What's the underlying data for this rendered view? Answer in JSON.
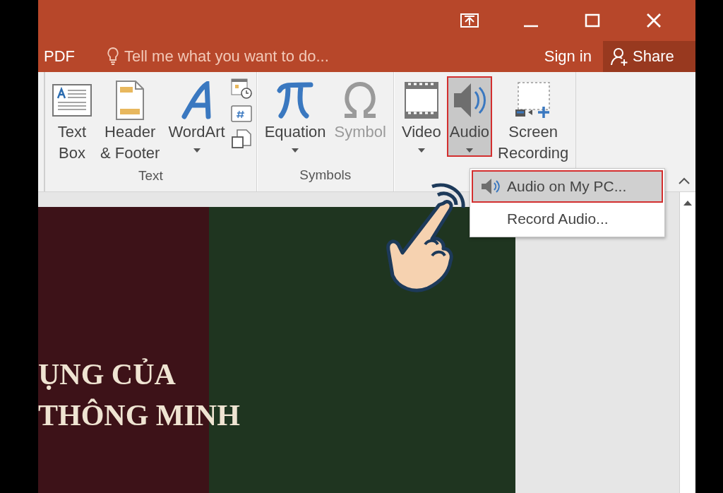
{
  "title_bar": {
    "controls": [
      {
        "kind": "ribbon_options"
      },
      {
        "kind": "minimize"
      },
      {
        "kind": "maximize"
      },
      {
        "kind": "close"
      }
    ]
  },
  "tell_me_row": {
    "tab": "PDF",
    "tell_me": {
      "placeholder": "Tell me what you want to do..."
    },
    "sign_in": "Sign in",
    "share": "Share"
  },
  "ribbon": {
    "groups": [
      {
        "label": "Text",
        "buttons": [
          {
            "kind": "large",
            "lines": [
              "Text",
              "Box"
            ],
            "dropdown": false,
            "disabled": false,
            "selected": false
          },
          {
            "kind": "large",
            "lines": [
              "Header",
              "& Footer"
            ],
            "dropdown": false,
            "disabled": false,
            "selected": false
          },
          {
            "kind": "large",
            "lines": [
              "WordArt"
            ],
            "dropdown": true,
            "disabled": false,
            "selected": false
          },
          {
            "kind": "small_column"
          }
        ]
      },
      {
        "label": "Symbols",
        "buttons": [
          {
            "kind": "large",
            "lines": [
              "Equation"
            ],
            "dropdown": true,
            "disabled": false,
            "selected": false
          },
          {
            "kind": "large",
            "lines": [
              "Symbol"
            ],
            "dropdown": false,
            "disabled": true,
            "selected": false
          }
        ]
      },
      {
        "buttons": [
          {
            "kind": "large",
            "lines": [
              "Video"
            ],
            "dropdown": true,
            "disabled": false,
            "selected": false
          },
          {
            "kind": "large",
            "lines": [
              "Audio"
            ],
            "dropdown": true,
            "disabled": false,
            "selected": true
          },
          {
            "kind": "large",
            "lines": [
              "Screen",
              "Recording"
            ],
            "dropdown": false,
            "disabled": false,
            "selected": false
          }
        ]
      }
    ]
  },
  "audio_menu": {
    "items": [
      {
        "label": "Audio on My PC...",
        "icon": true,
        "selected": true
      },
      {
        "label": "Record Audio...",
        "icon": false,
        "selected": false
      }
    ]
  },
  "slide": {
    "lines": [
      "ỤNG CỦA",
      "THÔNG MINH"
    ]
  }
}
